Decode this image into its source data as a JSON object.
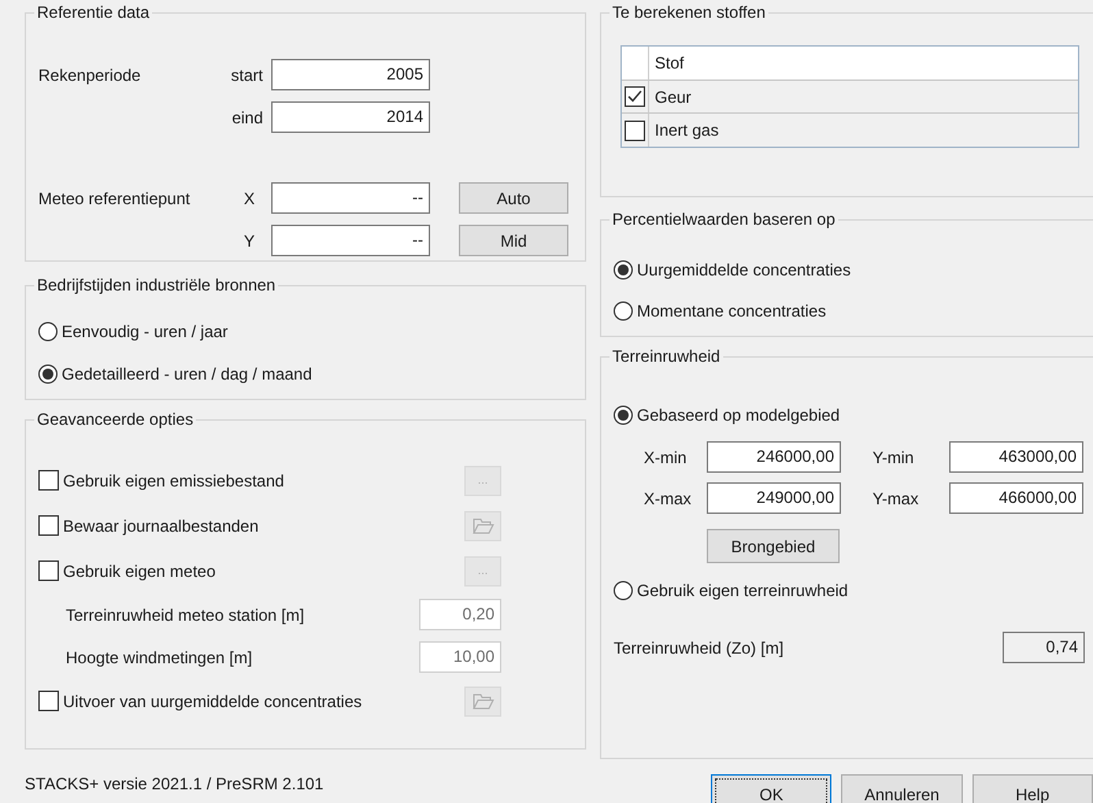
{
  "reference": {
    "title": "Referentie data",
    "period_label": "Rekenperiode",
    "start_label": "start",
    "start": "2005",
    "end_label": "eind",
    "end": "2014",
    "meteo_label": "Meteo referentiepunt",
    "x_label": "X",
    "x": "--",
    "y_label": "Y",
    "y": "--",
    "auto_button": "Auto",
    "mid_button": "Mid"
  },
  "operating_hours": {
    "title": "Bedrijfstijden industriële bronnen",
    "options": [
      {
        "label": "Eenvoudig - uren / jaar",
        "selected": false
      },
      {
        "label": "Gedetailleerd - uren / dag / maand",
        "selected": true
      }
    ]
  },
  "advanced": {
    "title": "Geavanceerde opties",
    "rows": [
      {
        "kind": "checkbox",
        "label": "Gebruik eigen emissiebestand",
        "checked": false,
        "action": {
          "kind": "ellipsis",
          "text": "...",
          "disabled": true
        }
      },
      {
        "kind": "checkbox",
        "label": "Bewaar journaalbestanden",
        "checked": false,
        "action": {
          "kind": "folder",
          "disabled": true
        }
      },
      {
        "kind": "checkbox",
        "label": "Gebruik eigen meteo",
        "checked": false,
        "action": {
          "kind": "ellipsis",
          "text": "...",
          "disabled": true
        }
      },
      {
        "kind": "value",
        "label": "Terreinruwheid meteo station [m]",
        "value": "0,20",
        "disabled": true
      },
      {
        "kind": "value",
        "label": "Hoogte windmetingen [m]",
        "value": "10,00",
        "disabled": true
      },
      {
        "kind": "checkbox",
        "label": "Uitvoer van uurgemiddelde concentraties",
        "checked": false,
        "action": {
          "kind": "folder",
          "disabled": true
        }
      }
    ]
  },
  "substances": {
    "title": "Te berekenen stoffen",
    "column": "Stof",
    "rows": [
      {
        "name": "Geur",
        "checked": true
      },
      {
        "name": "Inert gas",
        "checked": false
      }
    ]
  },
  "percentile": {
    "title": "Percentielwaarden baseren op",
    "options": [
      {
        "label": "Uurgemiddelde concentraties",
        "selected": true
      },
      {
        "label": "Momentane concentraties",
        "selected": false
      }
    ]
  },
  "terrain": {
    "title": "Terreinruwheid",
    "model_option": {
      "label": "Gebaseerd op modelgebied",
      "selected": true
    },
    "fields": [
      {
        "label": "X-min",
        "value": "246000,00"
      },
      {
        "label": "Y-min",
        "value": "463000,00"
      },
      {
        "label": "X-max",
        "value": "249000,00"
      },
      {
        "label": "Y-max",
        "value": "466000,00"
      }
    ],
    "area_button": "Brongebied",
    "own_option": {
      "label": "Gebruik eigen terreinruwheid",
      "selected": false
    },
    "result_label": "Terreinruwheid (Zo) [m]",
    "result_value": "0,74"
  },
  "footer": {
    "version": "STACKS+ versie 2021.1 / PreSRM 2.101",
    "buttons": [
      {
        "label": "OK",
        "focused": true
      },
      {
        "label": "Annuleren",
        "focused": false
      },
      {
        "label": "Help",
        "focused": false
      }
    ]
  }
}
